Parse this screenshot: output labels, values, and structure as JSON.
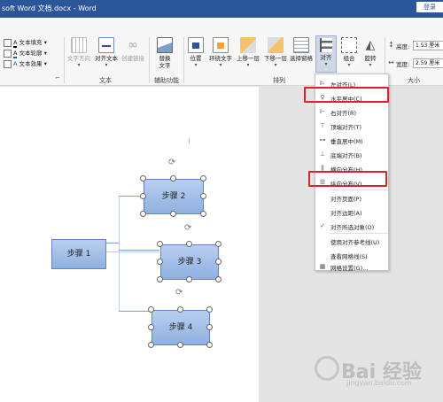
{
  "titlebar": {
    "title": "soft Word 文档.docx - Word",
    "login": "登录"
  },
  "ribbon": {
    "textfill": "文本填充",
    "textoutline": "文本轮廓",
    "texteffects": "文本效果",
    "text_direction": "文字方向",
    "align_text": "对齐文本",
    "create_link": "创建链接",
    "alt_text": "替换文字",
    "position": "位置",
    "wrap_text": "环绕文字",
    "bring_forward": "上移一层",
    "send_backward": "下移一层",
    "selection_pane": "选择窗格",
    "align": "对齐",
    "group": "组合",
    "rotate": "旋转",
    "height_label": "高度:",
    "height_value": "1.53 厘米",
    "width_label": "宽度:",
    "width_value": "2.59 厘米",
    "groups": {
      "text": "文本",
      "accessibility": "辅助功能",
      "arrange": "排列",
      "size": "大小"
    }
  },
  "shapes": {
    "step1": "步骤 1",
    "step2": "步骤 2",
    "step3": "步骤 3",
    "step4": "步骤 4"
  },
  "menu": {
    "items": [
      "左对齐(L)",
      "水平居中(C)",
      "右对齐(R)",
      "顶端对齐(T)",
      "垂直居中(M)",
      "底端对齐(B)",
      "横向分布(H)",
      "纵向分布(V)",
      "对齐页面(P)",
      "对齐边距(A)",
      "对齐所选对象(O)",
      "使用对齐参考线(U)",
      "查看网格线(S)",
      "网格设置(G)..."
    ],
    "checkmark": "✓"
  },
  "watermark": {
    "brand": "Bai 经验",
    "url": "jingyan.baidu.com"
  }
}
